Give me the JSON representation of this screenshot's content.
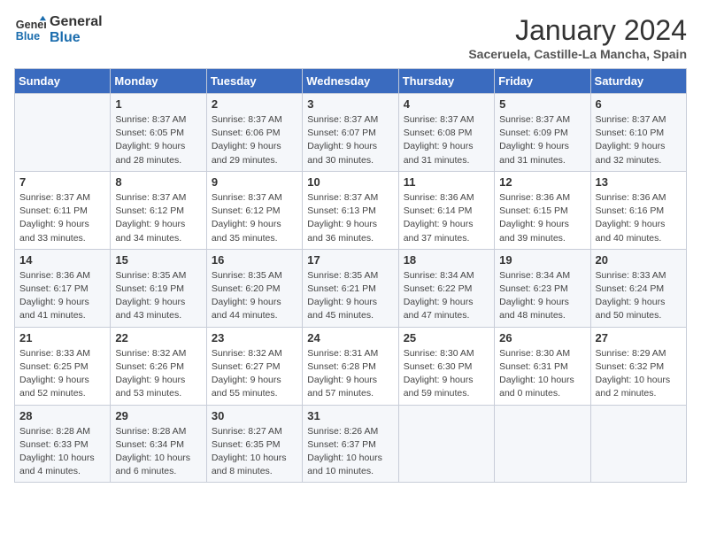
{
  "logo": {
    "text_general": "General",
    "text_blue": "Blue"
  },
  "header": {
    "month_year": "January 2024",
    "location": "Saceruela, Castille-La Mancha, Spain"
  },
  "days_of_week": [
    "Sunday",
    "Monday",
    "Tuesday",
    "Wednesday",
    "Thursday",
    "Friday",
    "Saturday"
  ],
  "weeks": [
    [
      {
        "day": "",
        "info": ""
      },
      {
        "day": "1",
        "info": "Sunrise: 8:37 AM\nSunset: 6:05 PM\nDaylight: 9 hours\nand 28 minutes."
      },
      {
        "day": "2",
        "info": "Sunrise: 8:37 AM\nSunset: 6:06 PM\nDaylight: 9 hours\nand 29 minutes."
      },
      {
        "day": "3",
        "info": "Sunrise: 8:37 AM\nSunset: 6:07 PM\nDaylight: 9 hours\nand 30 minutes."
      },
      {
        "day": "4",
        "info": "Sunrise: 8:37 AM\nSunset: 6:08 PM\nDaylight: 9 hours\nand 31 minutes."
      },
      {
        "day": "5",
        "info": "Sunrise: 8:37 AM\nSunset: 6:09 PM\nDaylight: 9 hours\nand 31 minutes."
      },
      {
        "day": "6",
        "info": "Sunrise: 8:37 AM\nSunset: 6:10 PM\nDaylight: 9 hours\nand 32 minutes."
      }
    ],
    [
      {
        "day": "7",
        "info": "Sunrise: 8:37 AM\nSunset: 6:11 PM\nDaylight: 9 hours\nand 33 minutes."
      },
      {
        "day": "8",
        "info": "Sunrise: 8:37 AM\nSunset: 6:12 PM\nDaylight: 9 hours\nand 34 minutes."
      },
      {
        "day": "9",
        "info": "Sunrise: 8:37 AM\nSunset: 6:12 PM\nDaylight: 9 hours\nand 35 minutes."
      },
      {
        "day": "10",
        "info": "Sunrise: 8:37 AM\nSunset: 6:13 PM\nDaylight: 9 hours\nand 36 minutes."
      },
      {
        "day": "11",
        "info": "Sunrise: 8:36 AM\nSunset: 6:14 PM\nDaylight: 9 hours\nand 37 minutes."
      },
      {
        "day": "12",
        "info": "Sunrise: 8:36 AM\nSunset: 6:15 PM\nDaylight: 9 hours\nand 39 minutes."
      },
      {
        "day": "13",
        "info": "Sunrise: 8:36 AM\nSunset: 6:16 PM\nDaylight: 9 hours\nand 40 minutes."
      }
    ],
    [
      {
        "day": "14",
        "info": "Sunrise: 8:36 AM\nSunset: 6:17 PM\nDaylight: 9 hours\nand 41 minutes."
      },
      {
        "day": "15",
        "info": "Sunrise: 8:35 AM\nSunset: 6:19 PM\nDaylight: 9 hours\nand 43 minutes."
      },
      {
        "day": "16",
        "info": "Sunrise: 8:35 AM\nSunset: 6:20 PM\nDaylight: 9 hours\nand 44 minutes."
      },
      {
        "day": "17",
        "info": "Sunrise: 8:35 AM\nSunset: 6:21 PM\nDaylight: 9 hours\nand 45 minutes."
      },
      {
        "day": "18",
        "info": "Sunrise: 8:34 AM\nSunset: 6:22 PM\nDaylight: 9 hours\nand 47 minutes."
      },
      {
        "day": "19",
        "info": "Sunrise: 8:34 AM\nSunset: 6:23 PM\nDaylight: 9 hours\nand 48 minutes."
      },
      {
        "day": "20",
        "info": "Sunrise: 8:33 AM\nSunset: 6:24 PM\nDaylight: 9 hours\nand 50 minutes."
      }
    ],
    [
      {
        "day": "21",
        "info": "Sunrise: 8:33 AM\nSunset: 6:25 PM\nDaylight: 9 hours\nand 52 minutes."
      },
      {
        "day": "22",
        "info": "Sunrise: 8:32 AM\nSunset: 6:26 PM\nDaylight: 9 hours\nand 53 minutes."
      },
      {
        "day": "23",
        "info": "Sunrise: 8:32 AM\nSunset: 6:27 PM\nDaylight: 9 hours\nand 55 minutes."
      },
      {
        "day": "24",
        "info": "Sunrise: 8:31 AM\nSunset: 6:28 PM\nDaylight: 9 hours\nand 57 minutes."
      },
      {
        "day": "25",
        "info": "Sunrise: 8:30 AM\nSunset: 6:30 PM\nDaylight: 9 hours\nand 59 minutes."
      },
      {
        "day": "26",
        "info": "Sunrise: 8:30 AM\nSunset: 6:31 PM\nDaylight: 10 hours\nand 0 minutes."
      },
      {
        "day": "27",
        "info": "Sunrise: 8:29 AM\nSunset: 6:32 PM\nDaylight: 10 hours\nand 2 minutes."
      }
    ],
    [
      {
        "day": "28",
        "info": "Sunrise: 8:28 AM\nSunset: 6:33 PM\nDaylight: 10 hours\nand 4 minutes."
      },
      {
        "day": "29",
        "info": "Sunrise: 8:28 AM\nSunset: 6:34 PM\nDaylight: 10 hours\nand 6 minutes."
      },
      {
        "day": "30",
        "info": "Sunrise: 8:27 AM\nSunset: 6:35 PM\nDaylight: 10 hours\nand 8 minutes."
      },
      {
        "day": "31",
        "info": "Sunrise: 8:26 AM\nSunset: 6:37 PM\nDaylight: 10 hours\nand 10 minutes."
      },
      {
        "day": "",
        "info": ""
      },
      {
        "day": "",
        "info": ""
      },
      {
        "day": "",
        "info": ""
      }
    ]
  ]
}
